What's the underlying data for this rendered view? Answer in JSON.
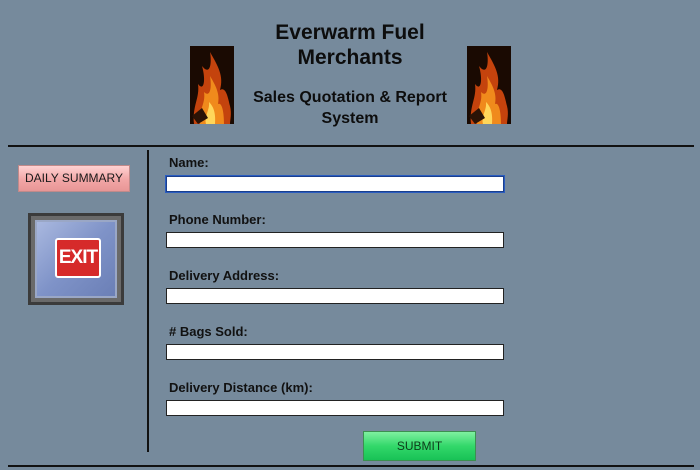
{
  "header": {
    "title": "Everwarm Fuel Merchants",
    "subtitle": "Sales Quotation & Report System"
  },
  "sidebar": {
    "daily_summary_label": "DAILY SUMMARY",
    "exit_label": "EXIT"
  },
  "form": {
    "fields": [
      {
        "label": "Name:",
        "value": ""
      },
      {
        "label": "Phone Number:",
        "value": ""
      },
      {
        "label": "Delivery Address:",
        "value": ""
      },
      {
        "label": "# Bags Sold:",
        "value": ""
      },
      {
        "label": "Delivery Distance (km):",
        "value": ""
      }
    ],
    "submit_label": "SUBMIT"
  },
  "colors": {
    "background": "#768a9c",
    "daily_button": "#f2a6a6",
    "submit_button": "#33d86a",
    "exit_sign": "#d62a2a"
  },
  "icons": {
    "left_image": "fire-image",
    "right_image": "fire-image",
    "exit_image": "exit-sign-icon"
  }
}
